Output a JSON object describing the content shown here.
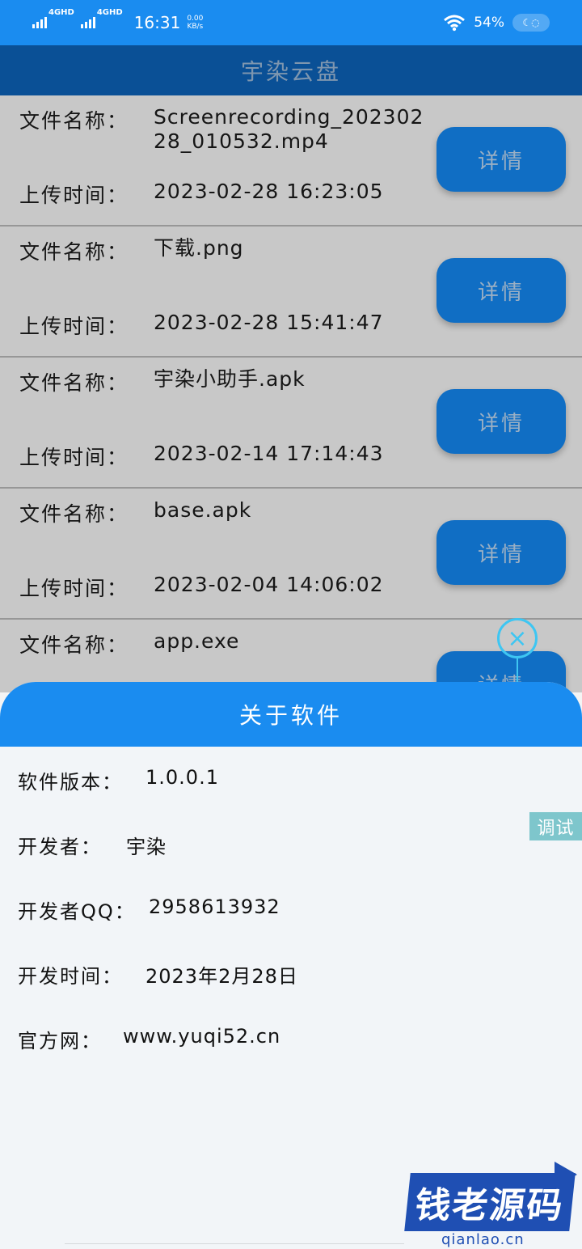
{
  "status_bar": {
    "net1": "4GHD",
    "net2": "4GHD",
    "time": "16:31",
    "speed_value": "0.00",
    "speed_unit": "KB/s",
    "battery": "54%"
  },
  "header": {
    "title": "宇染云盘"
  },
  "file_label_name": "文件名称：",
  "file_label_time": "上传时间：",
  "detail_label": "详情",
  "files": [
    {
      "name": "Screenrecording_20230228_010532.mp4",
      "time": "2023-02-28 16:23:05"
    },
    {
      "name": "下载.png",
      "time": "2023-02-28 15:41:47"
    },
    {
      "name": "宇染小助手.apk",
      "time": "2023-02-14 17:14:43"
    },
    {
      "name": "base.apk",
      "time": "2023-02-04 14:06:02"
    },
    {
      "name": "app.exe",
      "time": ""
    }
  ],
  "close_icon": "×",
  "about": {
    "title": "关于软件",
    "version_label": "软件版本：",
    "version": "1.0.0.1",
    "developer_label": "开发者：",
    "developer": "宇染",
    "qq_label": "开发者QQ：",
    "qq": "2958613932",
    "date_label": "开发时间：",
    "date": "2023年2月28日",
    "site_label": "官方网：",
    "site": "www.yuqi52.cn"
  },
  "debug_tag": "调试",
  "watermark": {
    "text": "钱老源码",
    "sub": "qianlao.cn"
  }
}
